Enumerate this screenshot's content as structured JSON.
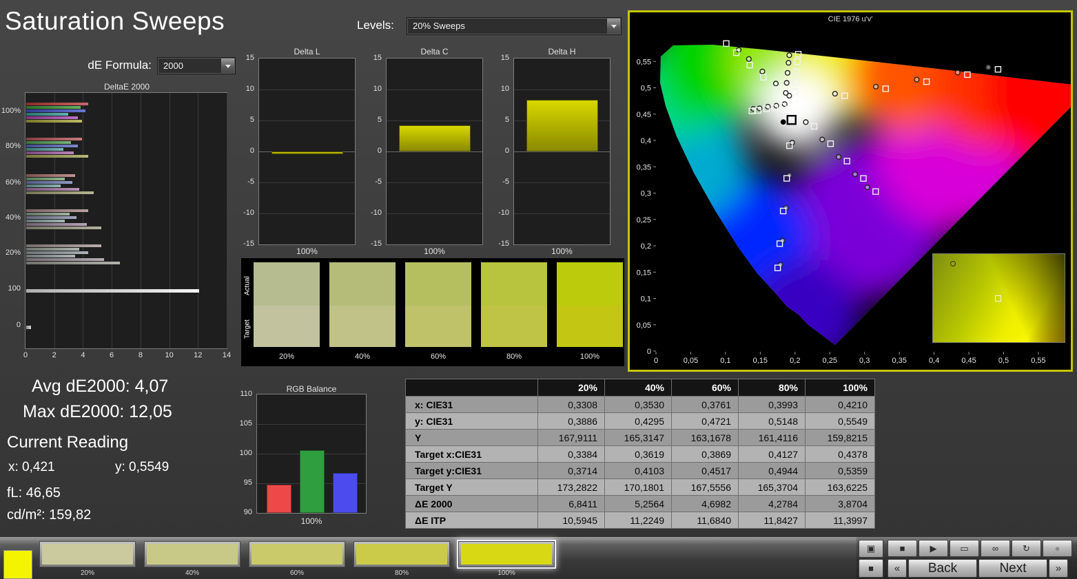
{
  "window": {
    "title": "Saturation Sweeps"
  },
  "toolbar": {
    "de_formula_label": "dE Formula:",
    "de_formula_value": "2000",
    "levels_label": "Levels:",
    "levels_value": "20% Sweeps"
  },
  "stats": {
    "avg_label": "Avg dE2000: 4,07",
    "max_label": "Max dE2000: 12,05",
    "current_reading": "Current Reading",
    "x": "x: 0,421",
    "y": "y: 0,5549",
    "fl": "fL: 46,65",
    "cd": "cd/m²: 159,82"
  },
  "chart_data": [
    {
      "id": "deltae2000",
      "type": "bar",
      "orientation": "horizontal",
      "title": "DeltaE 2000",
      "xlim": [
        0,
        14
      ],
      "xticks": [
        0,
        2,
        4,
        6,
        8,
        10,
        12,
        14
      ],
      "groups": [
        {
          "label": "100%",
          "values": [
            4.3,
            3.8,
            4.1,
            2.9,
            3.6,
            3.9
          ],
          "colors": [
            "#c03a3a",
            "#3a9a3a",
            "#4050c8",
            "#38a0a0",
            "#b048b0",
            "#a8a83a"
          ]
        },
        {
          "label": "80%",
          "values": [
            3.9,
            3.1,
            3.6,
            2.6,
            3.3,
            4.3
          ],
          "colors": [
            "#b85555",
            "#55a055",
            "#5868c0",
            "#55a0a0",
            "#a862a8",
            "#a4a455"
          ]
        },
        {
          "label": "60%",
          "values": [
            3.4,
            2.7,
            3.2,
            2.4,
            3.7,
            4.7
          ],
          "colors": [
            "#b07272",
            "#72a072",
            "#7280b8",
            "#72a0a0",
            "#a478a4",
            "#a0a072"
          ]
        },
        {
          "label": "40%",
          "values": [
            4.3,
            3.0,
            3.5,
            2.7,
            4.2,
            5.2
          ],
          "colors": [
            "#a88888",
            "#88a088",
            "#8890a8",
            "#88a0a0",
            "#a08aa0",
            "#9c9c88"
          ]
        },
        {
          "label": "20%",
          "values": [
            5.2,
            3.7,
            4.3,
            3.4,
            5.4,
            6.5
          ],
          "colors": [
            "#a49797",
            "#97a097",
            "#97a0a4",
            "#97a0a0",
            "#a097a0",
            "#9e9e97"
          ]
        },
        {
          "label": "100",
          "values": [
            12.05
          ],
          "colors": [
            "#f2f2f2"
          ]
        },
        {
          "label": "0",
          "values": [
            0.35
          ],
          "colors": [
            "#c8c8c8"
          ]
        }
      ]
    },
    {
      "id": "delta_l",
      "type": "bar",
      "title": "Delta L",
      "categories": [
        "100%"
      ],
      "values": [
        -0.4
      ],
      "ylim": [
        -15,
        15
      ],
      "yticks": [
        15,
        10,
        5,
        0,
        -5,
        -10,
        -15
      ]
    },
    {
      "id": "delta_c",
      "type": "bar",
      "title": "Delta C",
      "categories": [
        "100%"
      ],
      "values": [
        4.2
      ],
      "ylim": [
        -15,
        15
      ],
      "yticks": [
        15,
        10,
        5,
        0,
        -5,
        -10,
        -15
      ]
    },
    {
      "id": "delta_h",
      "type": "bar",
      "title": "Delta H",
      "categories": [
        "100%"
      ],
      "values": [
        8.3
      ],
      "ylim": [
        -15,
        15
      ],
      "yticks": [
        15,
        10,
        5,
        0,
        -5,
        -10,
        -15
      ]
    },
    {
      "id": "rgb_balance",
      "type": "bar",
      "title": "RGB Balance",
      "categories": [
        "Red",
        "Green",
        "Blue"
      ],
      "values": [
        94.8,
        100.6,
        96.7
      ],
      "colors": [
        "#ee4848",
        "#2f9e3f",
        "#4b4bee"
      ],
      "ylim": [
        90,
        110
      ],
      "yticks": [
        110,
        105,
        100,
        95,
        90
      ],
      "xlabel": "100%"
    },
    {
      "id": "cie1976",
      "type": "scatter",
      "title": "CIE 1976 u'v'",
      "xlim": [
        0,
        0.55
      ],
      "ylim": [
        0,
        0.55
      ],
      "xticks": [
        "0",
        "0,05",
        "0,1",
        "0,15",
        "0,2",
        "0,25",
        "0,3",
        "0,35",
        "0,4",
        "0,45",
        "0,5",
        "0,55"
      ],
      "yticks": [
        "0",
        "0,05",
        "0,1",
        "0,15",
        "0,2",
        "0,25",
        "0,3",
        "0,35",
        "0,4",
        "0,45",
        "0,5",
        "0,55"
      ],
      "targets": [
        [
          0.2715,
          0.4848
        ],
        [
          0.3303,
          0.4982
        ],
        [
          0.3891,
          0.5116
        ],
        [
          0.4479,
          0.525
        ],
        [
          0.492,
          0.535
        ],
        [
          0.1737,
          0.497
        ],
        [
          0.1544,
          0.52
        ],
        [
          0.135,
          0.543
        ],
        [
          0.1156,
          0.5666
        ],
        [
          0.101,
          0.584
        ],
        [
          0.192,
          0.39
        ],
        [
          0.188,
          0.328
        ],
        [
          0.183,
          0.266
        ],
        [
          0.178,
          0.204
        ],
        [
          0.175,
          0.158
        ],
        [
          0.183,
          0.465
        ],
        [
          0.171,
          0.462
        ],
        [
          0.159,
          0.46
        ],
        [
          0.147,
          0.457
        ],
        [
          0.138,
          0.456
        ],
        [
          0.2275,
          0.4268
        ],
        [
          0.2511,
          0.3938
        ],
        [
          0.2747,
          0.3608
        ],
        [
          0.2983,
          0.3278
        ],
        [
          0.316,
          0.303
        ],
        [
          0.1997,
          0.4922
        ],
        [
          0.201,
          0.5113
        ],
        [
          0.2023,
          0.5304
        ],
        [
          0.2036,
          0.5495
        ],
        [
          0.2047,
          0.5638
        ]
      ],
      "measurements": [
        [
          0.2575,
          0.4888
        ],
        [
          0.3163,
          0.5022
        ],
        [
          0.3751,
          0.5156
        ],
        [
          0.4339,
          0.529
        ],
        [
          0.478,
          0.539
        ],
        [
          0.1917,
          0.485
        ],
        [
          0.1724,
          0.508
        ],
        [
          0.153,
          0.531
        ],
        [
          0.1336,
          0.5546
        ],
        [
          0.119,
          0.572
        ],
        [
          0.196,
          0.396
        ],
        [
          0.192,
          0.334
        ],
        [
          0.187,
          0.272
        ],
        [
          0.182,
          0.21
        ],
        [
          0.179,
          0.164
        ],
        [
          0.185,
          0.469
        ],
        [
          0.173,
          0.466
        ],
        [
          0.161,
          0.464
        ],
        [
          0.149,
          0.461
        ],
        [
          0.14,
          0.46
        ],
        [
          0.2155,
          0.4348
        ],
        [
          0.2391,
          0.4018
        ],
        [
          0.2627,
          0.3688
        ],
        [
          0.2863,
          0.3358
        ],
        [
          0.304,
          0.311
        ],
        [
          0.1867,
          0.4902
        ],
        [
          0.188,
          0.5093
        ],
        [
          0.1893,
          0.5284
        ],
        [
          0.1906,
          0.5475
        ],
        [
          0.1917,
          0.5618
        ]
      ],
      "current": {
        "square": [
          0.195,
          0.439
        ],
        "circle": [
          0.183,
          0.435
        ]
      }
    }
  ],
  "swatch_panel": {
    "row_labels": [
      "Actual",
      "Target"
    ],
    "levels": [
      "20%",
      "40%",
      "60%",
      "80%",
      "100%"
    ],
    "actual_colors": [
      "#b6bb90",
      "#b5bc7a",
      "#b6bf60",
      "#b8c33e",
      "#bccb0c"
    ],
    "target_colors": [
      "#c2c39e",
      "#c0c287",
      "#bfc268",
      "#c0c446",
      "#c3c714"
    ]
  },
  "table": {
    "columns": [
      "20%",
      "40%",
      "60%",
      "80%",
      "100%"
    ],
    "rows": [
      {
        "label": "x: CIE31",
        "values": [
          "0,3308",
          "0,3530",
          "0,3761",
          "0,3993",
          "0,4210"
        ]
      },
      {
        "label": "y: CIE31",
        "values": [
          "0,3886",
          "0,4295",
          "0,4721",
          "0,5148",
          "0,5549"
        ]
      },
      {
        "label": "Y",
        "values": [
          "167,9111",
          "165,3147",
          "163,1678",
          "161,4116",
          "159,8215"
        ]
      },
      {
        "label": "Target x:CIE31",
        "values": [
          "0,3384",
          "0,3619",
          "0,3869",
          "0,4127",
          "0,4378"
        ]
      },
      {
        "label": "Target y:CIE31",
        "values": [
          "0,3714",
          "0,4103",
          "0,4517",
          "0,4944",
          "0,5359"
        ]
      },
      {
        "label": "Target Y",
        "values": [
          "173,2822",
          "170,1801",
          "167,5556",
          "165,3704",
          "163,6225"
        ]
      },
      {
        "label": "ΔE 2000",
        "values": [
          "6,8411",
          "5,2564",
          "4,6982",
          "4,2784",
          "3,8704"
        ]
      },
      {
        "label": "ΔE ITP",
        "values": [
          "10,5945",
          "11,2249",
          "11,6840",
          "11,8427",
          "11,3997"
        ]
      }
    ]
  },
  "bottom_bar": {
    "current_patch_color": "#f4f400",
    "patches": [
      {
        "label": "20%",
        "color": "#caca9e",
        "selected": false
      },
      {
        "label": "40%",
        "color": "#c9c987",
        "selected": false
      },
      {
        "label": "60%",
        "color": "#caca6a",
        "selected": false
      },
      {
        "label": "80%",
        "color": "#cbcb49",
        "selected": false
      },
      {
        "label": "100%",
        "color": "#d8d815",
        "selected": true
      }
    ],
    "transport": {
      "back_label": "Back",
      "next_label": "Next",
      "prev_glyph": "«",
      "fwd_glyph": "»",
      "icons": [
        {
          "name": "stop-icon",
          "glyph": "■",
          "dim": false
        },
        {
          "name": "play-icon",
          "glyph": "▶",
          "dim": false
        },
        {
          "name": "window-icon",
          "glyph": "▭",
          "dim": false
        },
        {
          "name": "loop-icon",
          "glyph": "∞",
          "dim": false
        },
        {
          "name": "refresh-icon",
          "glyph": "↻",
          "dim": false
        },
        {
          "name": "record-icon",
          "glyph": "●",
          "dim": true
        }
      ],
      "side_icons": [
        {
          "name": "display-icon",
          "glyph": "▣"
        },
        {
          "name": "stop-pattern-icon",
          "glyph": "■"
        }
      ]
    }
  }
}
